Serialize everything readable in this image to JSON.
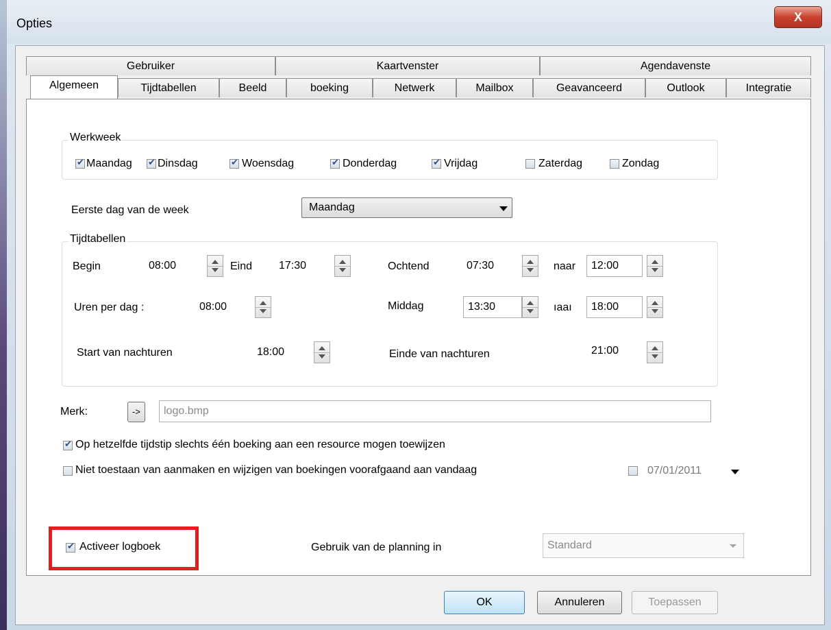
{
  "window": {
    "title": "Opties",
    "close_label": "X"
  },
  "tabs_top": [
    "Gebruiker",
    "Kaartvenster",
    "Agendavenste"
  ],
  "tabs_bottom": [
    "Algemeen",
    "Tijdtabellen",
    "Beeld",
    "boeking",
    "Netwerk",
    "Mailbox",
    "Geavanceerd",
    "Outlook",
    "Integratie"
  ],
  "werkweek": {
    "label": "Werkweek",
    "days": [
      {
        "label": "Maandag",
        "checked": true
      },
      {
        "label": "Dinsdag",
        "checked": true
      },
      {
        "label": "Woensdag",
        "checked": true
      },
      {
        "label": "Donderdag",
        "checked": true
      },
      {
        "label": "Vrijdag",
        "checked": true
      },
      {
        "label": "Zaterdag",
        "checked": false
      },
      {
        "label": "Zondag",
        "checked": false
      }
    ]
  },
  "first_day": {
    "label": "Eerste dag van de week",
    "value": "Maandag"
  },
  "tijdtabellen": {
    "label": "Tijdtabellen",
    "begin_label": "Begin",
    "begin_value": "08:00",
    "eind_label": "Eind",
    "eind_value": "17:30",
    "ochtend_label": "Ochtend",
    "ochtend_from": "07:30",
    "ochtend_naar_label": "naar",
    "ochtend_to": "12:00",
    "uren_label": "Uren per dag :",
    "uren_value": "08:00",
    "middag_label": "Middag",
    "middag_from": "13:30",
    "middag_naar_label": "ıaaı",
    "middag_to": "18:00",
    "start_nacht_label": "Start van nachturen",
    "start_nacht_value": "18:00",
    "einde_nacht_label": "Einde van nachturen",
    "einde_nacht_value": "21:00"
  },
  "merk": {
    "label": "Merk:",
    "browse_label": "->",
    "value": "logo.bmp"
  },
  "options": {
    "single_booking": {
      "label": "Op hetzelfde tijdstip slechts één boeking  aan een resource mogen toewijzen",
      "checked": true
    },
    "no_past": {
      "label": "Niet toestaan van aanmaken en wijzigen van boekingen voorafgaand aan vandaag",
      "checked": false
    },
    "date_value": "07/01/2011",
    "logbook": {
      "label": "Activeer logboek",
      "checked": true
    },
    "planning_label": "Gebruik van de planning in",
    "planning_value": "Standard"
  },
  "buttons": {
    "ok": "OK",
    "cancel": "Annuleren",
    "apply": "Toepassen"
  },
  "colors": {
    "highlight": "#e02020",
    "close_button": "#c9422e"
  }
}
